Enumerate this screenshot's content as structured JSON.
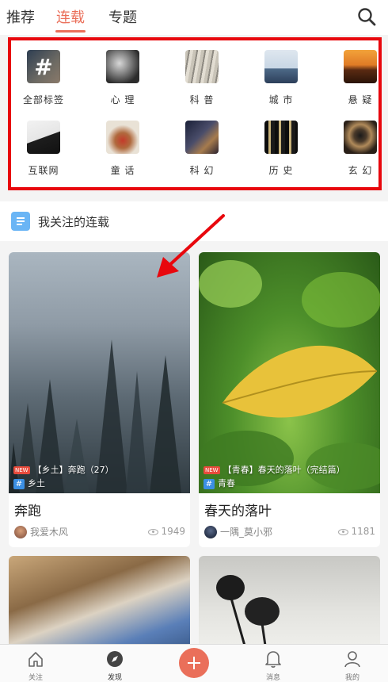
{
  "top_tabs": [
    {
      "label": "推荐",
      "active": false
    },
    {
      "label": "连载",
      "active": true
    },
    {
      "label": "专题",
      "active": false
    }
  ],
  "search_icon": "search-icon",
  "categories": [
    {
      "label": "全部标签",
      "icon": "hash-icon"
    },
    {
      "label": "心 理",
      "icon": "face-photo"
    },
    {
      "label": "科 普",
      "icon": "book-photo"
    },
    {
      "label": "城 市",
      "icon": "skyline-photo"
    },
    {
      "label": "悬 疑",
      "icon": "dusk-photo"
    },
    {
      "label": "互联网",
      "icon": "laptop-photo"
    },
    {
      "label": "童 话",
      "icon": "reindeer-photo"
    },
    {
      "label": "科 幻",
      "icon": "galaxy-photo"
    },
    {
      "label": "历 史",
      "icon": "pillars-photo"
    },
    {
      "label": "玄 幻",
      "icon": "tunnel-photo"
    }
  ],
  "follow": {
    "title": "我关注的连载",
    "icon": "document-icon"
  },
  "cards": [
    {
      "badge": "NEW",
      "series": "【乡土】奔跑（27）",
      "tag": "乡土",
      "title": "奔跑",
      "author": "我爱木风",
      "views": "1949"
    },
    {
      "badge": "NEW",
      "series": "【青春】春天的落叶（完结篇）",
      "tag": "青春",
      "title": "春天的落叶",
      "author": "一隅_莫小邪",
      "views": "1181"
    }
  ],
  "bottom_nav": [
    {
      "label": "关注",
      "icon": "home-icon"
    },
    {
      "label": "发现",
      "icon": "compass-icon",
      "active": true
    },
    {
      "label": "",
      "icon": "plus-icon"
    },
    {
      "label": "消息",
      "icon": "bell-icon"
    },
    {
      "label": "我的",
      "icon": "person-icon"
    }
  ],
  "colors": {
    "accent": "#ea6f5a",
    "highlight_box": "#e8070d",
    "arrow": "#e8070d",
    "tag_blue": "#3b8fe4"
  }
}
